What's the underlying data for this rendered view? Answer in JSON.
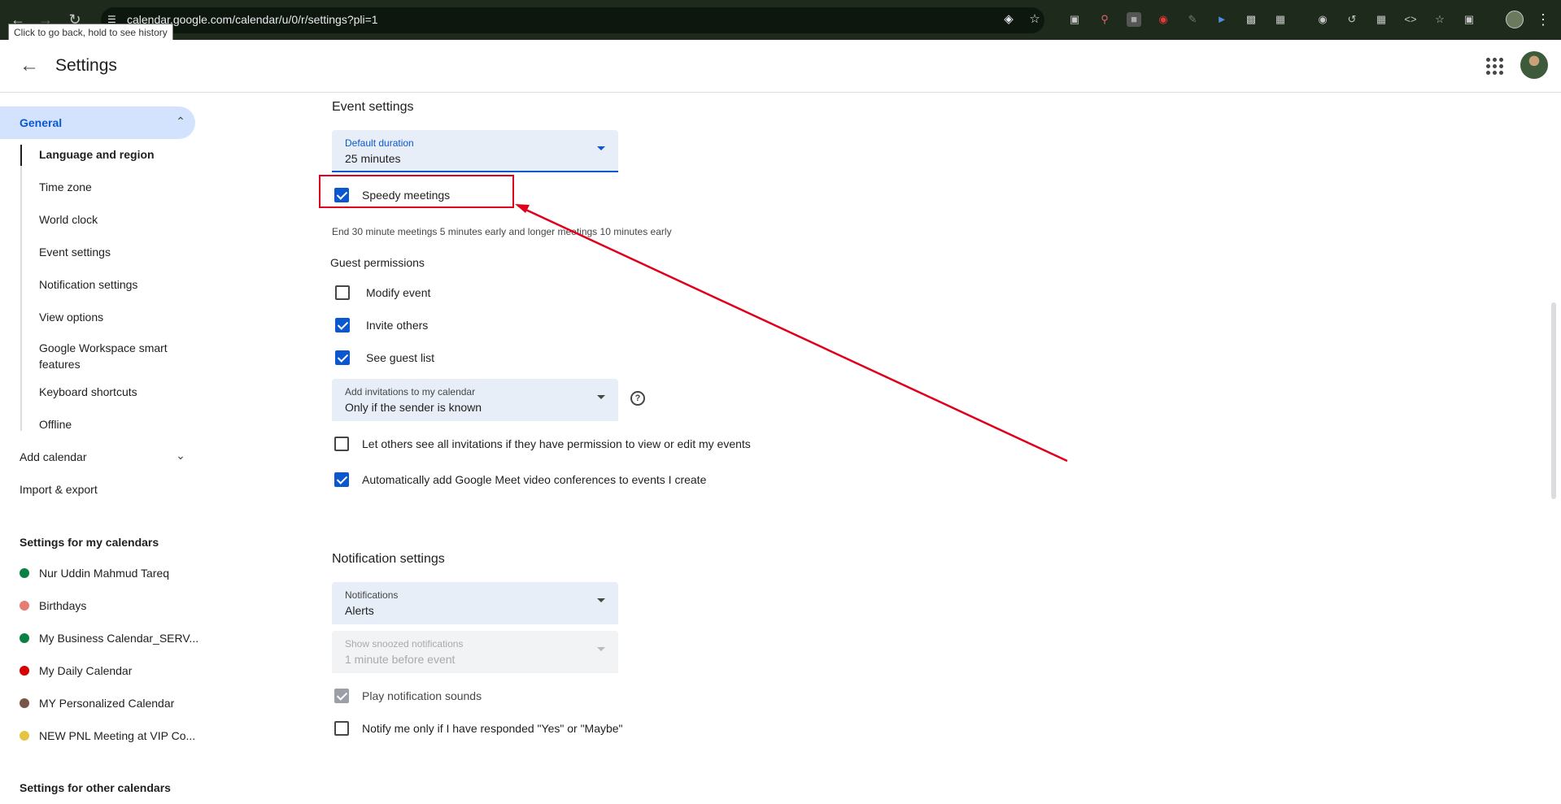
{
  "browser": {
    "url": "calendar.google.com/calendar/u/0/r/settings?pli=1",
    "back_tooltip": "Click to go back, hold to see history"
  },
  "header": {
    "title": "Settings"
  },
  "sidebar": {
    "general_label": "General",
    "general_items": [
      {
        "label": "Language and region"
      },
      {
        "label": "Time zone"
      },
      {
        "label": "World clock"
      },
      {
        "label": "Event settings"
      },
      {
        "label": "Notification settings"
      },
      {
        "label": "View options"
      },
      {
        "label": "Google Workspace smart features"
      },
      {
        "label": "Keyboard shortcuts"
      },
      {
        "label": "Offline"
      }
    ],
    "add_calendar": "Add calendar",
    "import_export": "Import & export",
    "my_calendars_header": "Settings for my calendars",
    "my_calendars": [
      {
        "label": "Nur Uddin Mahmud Tareq",
        "color": "#0b8043"
      },
      {
        "label": "Birthdays",
        "color": "#e67c73"
      },
      {
        "label": "My Business Calendar_SERV...",
        "color": "#0b8043"
      },
      {
        "label": "My Daily Calendar",
        "color": "#d50000"
      },
      {
        "label": "MY Personalized Calendar",
        "color": "#795548"
      },
      {
        "label": "NEW PNL Meeting at VIP Co...",
        "color": "#e4c441"
      }
    ],
    "other_calendars_header": "Settings for other calendars"
  },
  "event_settings": {
    "title": "Event settings",
    "default_duration": {
      "label": "Default duration",
      "value": "25 minutes"
    },
    "speedy_meetings": {
      "label": "Speedy meetings",
      "checked": true
    },
    "speedy_desc": "End 30 minute meetings 5 minutes early and longer meetings 10 minutes early",
    "guest_permissions_title": "Guest permissions",
    "guest_permissions": [
      {
        "label": "Modify event",
        "checked": false
      },
      {
        "label": "Invite others",
        "checked": true
      },
      {
        "label": "See guest list",
        "checked": true
      }
    ],
    "add_invitations": {
      "label": "Add invitations to my calendar",
      "value": "Only if the sender is known"
    },
    "help_icon": "help-circle-icon",
    "let_others_see": {
      "label": "Let others see all invitations if they have permission to view or edit my events",
      "checked": false
    },
    "auto_meet": {
      "label": "Automatically add Google Meet video conferences to events I create",
      "checked": true
    }
  },
  "notification_settings": {
    "title": "Notification settings",
    "notifications": {
      "label": "Notifications",
      "value": "Alerts"
    },
    "snoozed": {
      "label": "Show snoozed notifications",
      "value": "1 minute before event"
    },
    "play_sounds": {
      "label": "Play notification sounds",
      "checked": true
    },
    "notify_only": {
      "label": "Notify me only if I have responded \"Yes\" or \"Maybe\"",
      "checked": false
    }
  },
  "colors": {
    "accent": "#0b57d0",
    "selected_nav_bg": "#d3e3fd",
    "annotation_red": "#e0001b",
    "browser_frame": "#1e2a1c"
  }
}
